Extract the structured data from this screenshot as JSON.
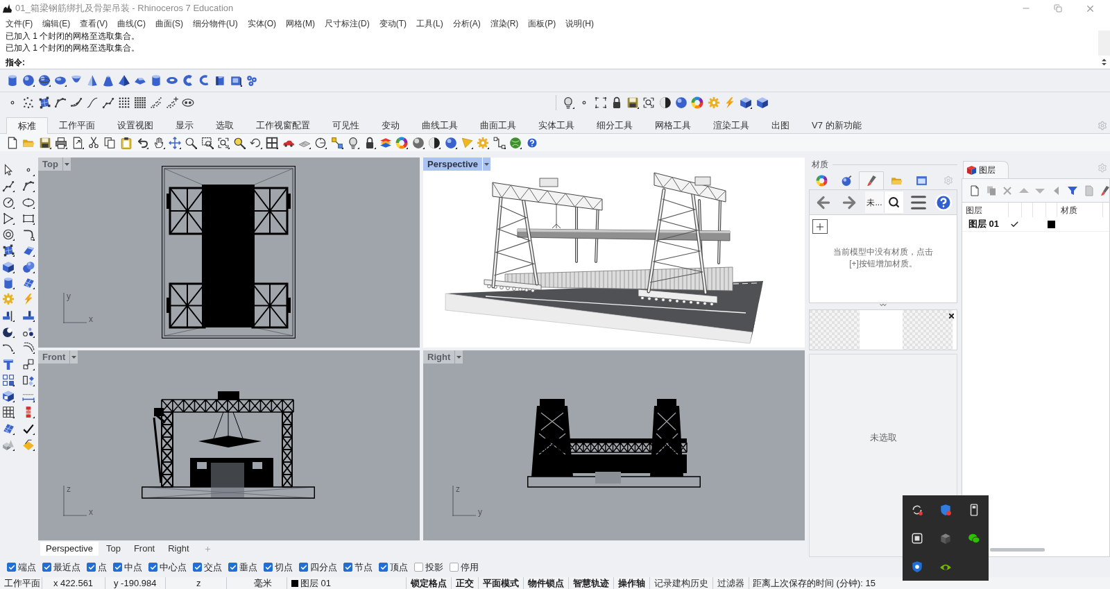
{
  "window": {
    "title": "01_箱梁钢筋绑扎及骨架吊装 - Rhinoceros 7 Education"
  },
  "menu": [
    "文件(F)",
    "编辑(E)",
    "查看(V)",
    "曲线(C)",
    "曲面(S)",
    "细分物件(U)",
    "实体(O)",
    "网格(M)",
    "尺寸标注(D)",
    "变动(T)",
    "工具(L)",
    "分析(A)",
    "渲染(R)",
    "面板(P)",
    "说明(H)"
  ],
  "command": {
    "history": [
      "已加入 1 个封闭的网格至选取集合。",
      "已加入 1 个封闭的网格至选取集合。"
    ],
    "prompt": "指令:"
  },
  "toolbar_tabs": [
    {
      "label": "标准",
      "selected": true
    },
    {
      "label": "工作平面",
      "selected": false
    },
    {
      "label": "设置视图",
      "selected": false
    },
    {
      "label": "显示",
      "selected": false
    },
    {
      "label": "选取",
      "selected": false
    },
    {
      "label": "工作视窗配置",
      "selected": false
    },
    {
      "label": "可见性",
      "selected": false
    },
    {
      "label": "变动",
      "selected": false
    },
    {
      "label": "曲线工具",
      "selected": false
    },
    {
      "label": "曲面工具",
      "selected": false
    },
    {
      "label": "实体工具",
      "selected": false
    },
    {
      "label": "细分工具",
      "selected": false
    },
    {
      "label": "网格工具",
      "selected": false
    },
    {
      "label": "渲染工具",
      "selected": false
    },
    {
      "label": "出图",
      "selected": false
    },
    {
      "label": "V7 的新功能",
      "selected": false
    }
  ],
  "viewports": [
    {
      "kind": "top",
      "label": "Top",
      "selected": false,
      "axes": {
        "vertical": "y",
        "horizontal": "x"
      }
    },
    {
      "kind": "perspective",
      "label": "Perspective",
      "selected": true
    },
    {
      "kind": "front",
      "label": "Front",
      "selected": false,
      "axes": {
        "vertical": "z",
        "horizontal": "x"
      }
    },
    {
      "kind": "right",
      "label": "Right",
      "selected": false,
      "axes": {
        "vertical": "z",
        "horizontal": "y"
      }
    }
  ],
  "viewport_tabs": [
    {
      "label": "Perspective",
      "selected": true
    },
    {
      "label": "Top",
      "selected": false
    },
    {
      "label": "Front",
      "selected": false
    },
    {
      "label": "Right",
      "selected": false
    }
  ],
  "materials_panel": {
    "title": "材质",
    "tabs": [
      {
        "selected": false
      },
      {
        "selected": false
      },
      {
        "selected": true
      },
      {
        "selected": false
      },
      {
        "selected": false
      }
    ],
    "filter_value": "未...",
    "message": "当前模型中没有材质，点击[+]按钮增加材质。",
    "selection_status": "未选取"
  },
  "layers_panel": {
    "tab": "图层",
    "columns": {
      "name": "图层",
      "material": "材质"
    },
    "rows": [
      {
        "name": "图层 01",
        "current": true,
        "color": "#000000"
      }
    ]
  },
  "osnaps": [
    {
      "label": "端点",
      "checked": true
    },
    {
      "label": "最近点",
      "checked": true
    },
    {
      "label": "点",
      "checked": true
    },
    {
      "label": "中点",
      "checked": true
    },
    {
      "label": "中心点",
      "checked": true
    },
    {
      "label": "交点",
      "checked": true
    },
    {
      "label": "垂点",
      "checked": true
    },
    {
      "label": "切点",
      "checked": true
    },
    {
      "label": "四分点",
      "checked": true
    },
    {
      "label": "节点",
      "checked": true
    },
    {
      "label": "顶点",
      "checked": true
    },
    {
      "label": "投影",
      "checked": false
    },
    {
      "label": "停用",
      "checked": false
    }
  ],
  "status_bar": {
    "workplane": "工作平面",
    "x": "x 422.561",
    "y": "y -190.984",
    "z": "z",
    "units": "毫米",
    "layer": {
      "name": "图层 01",
      "color": "#000000"
    },
    "toggles": [
      {
        "label": "锁定格点",
        "on": true
      },
      {
        "label": "正交",
        "on": true
      },
      {
        "label": "平面模式",
        "on": true
      },
      {
        "label": "物件锁点",
        "on": true
      },
      {
        "label": "智慧轨迹",
        "on": true
      },
      {
        "label": "操作轴",
        "on": true
      },
      {
        "label": "记录建构历史",
        "on": false
      },
      {
        "label": "过滤器",
        "on": false
      }
    ],
    "save_time": "距离上次保存的时间 (分钟): 15"
  }
}
